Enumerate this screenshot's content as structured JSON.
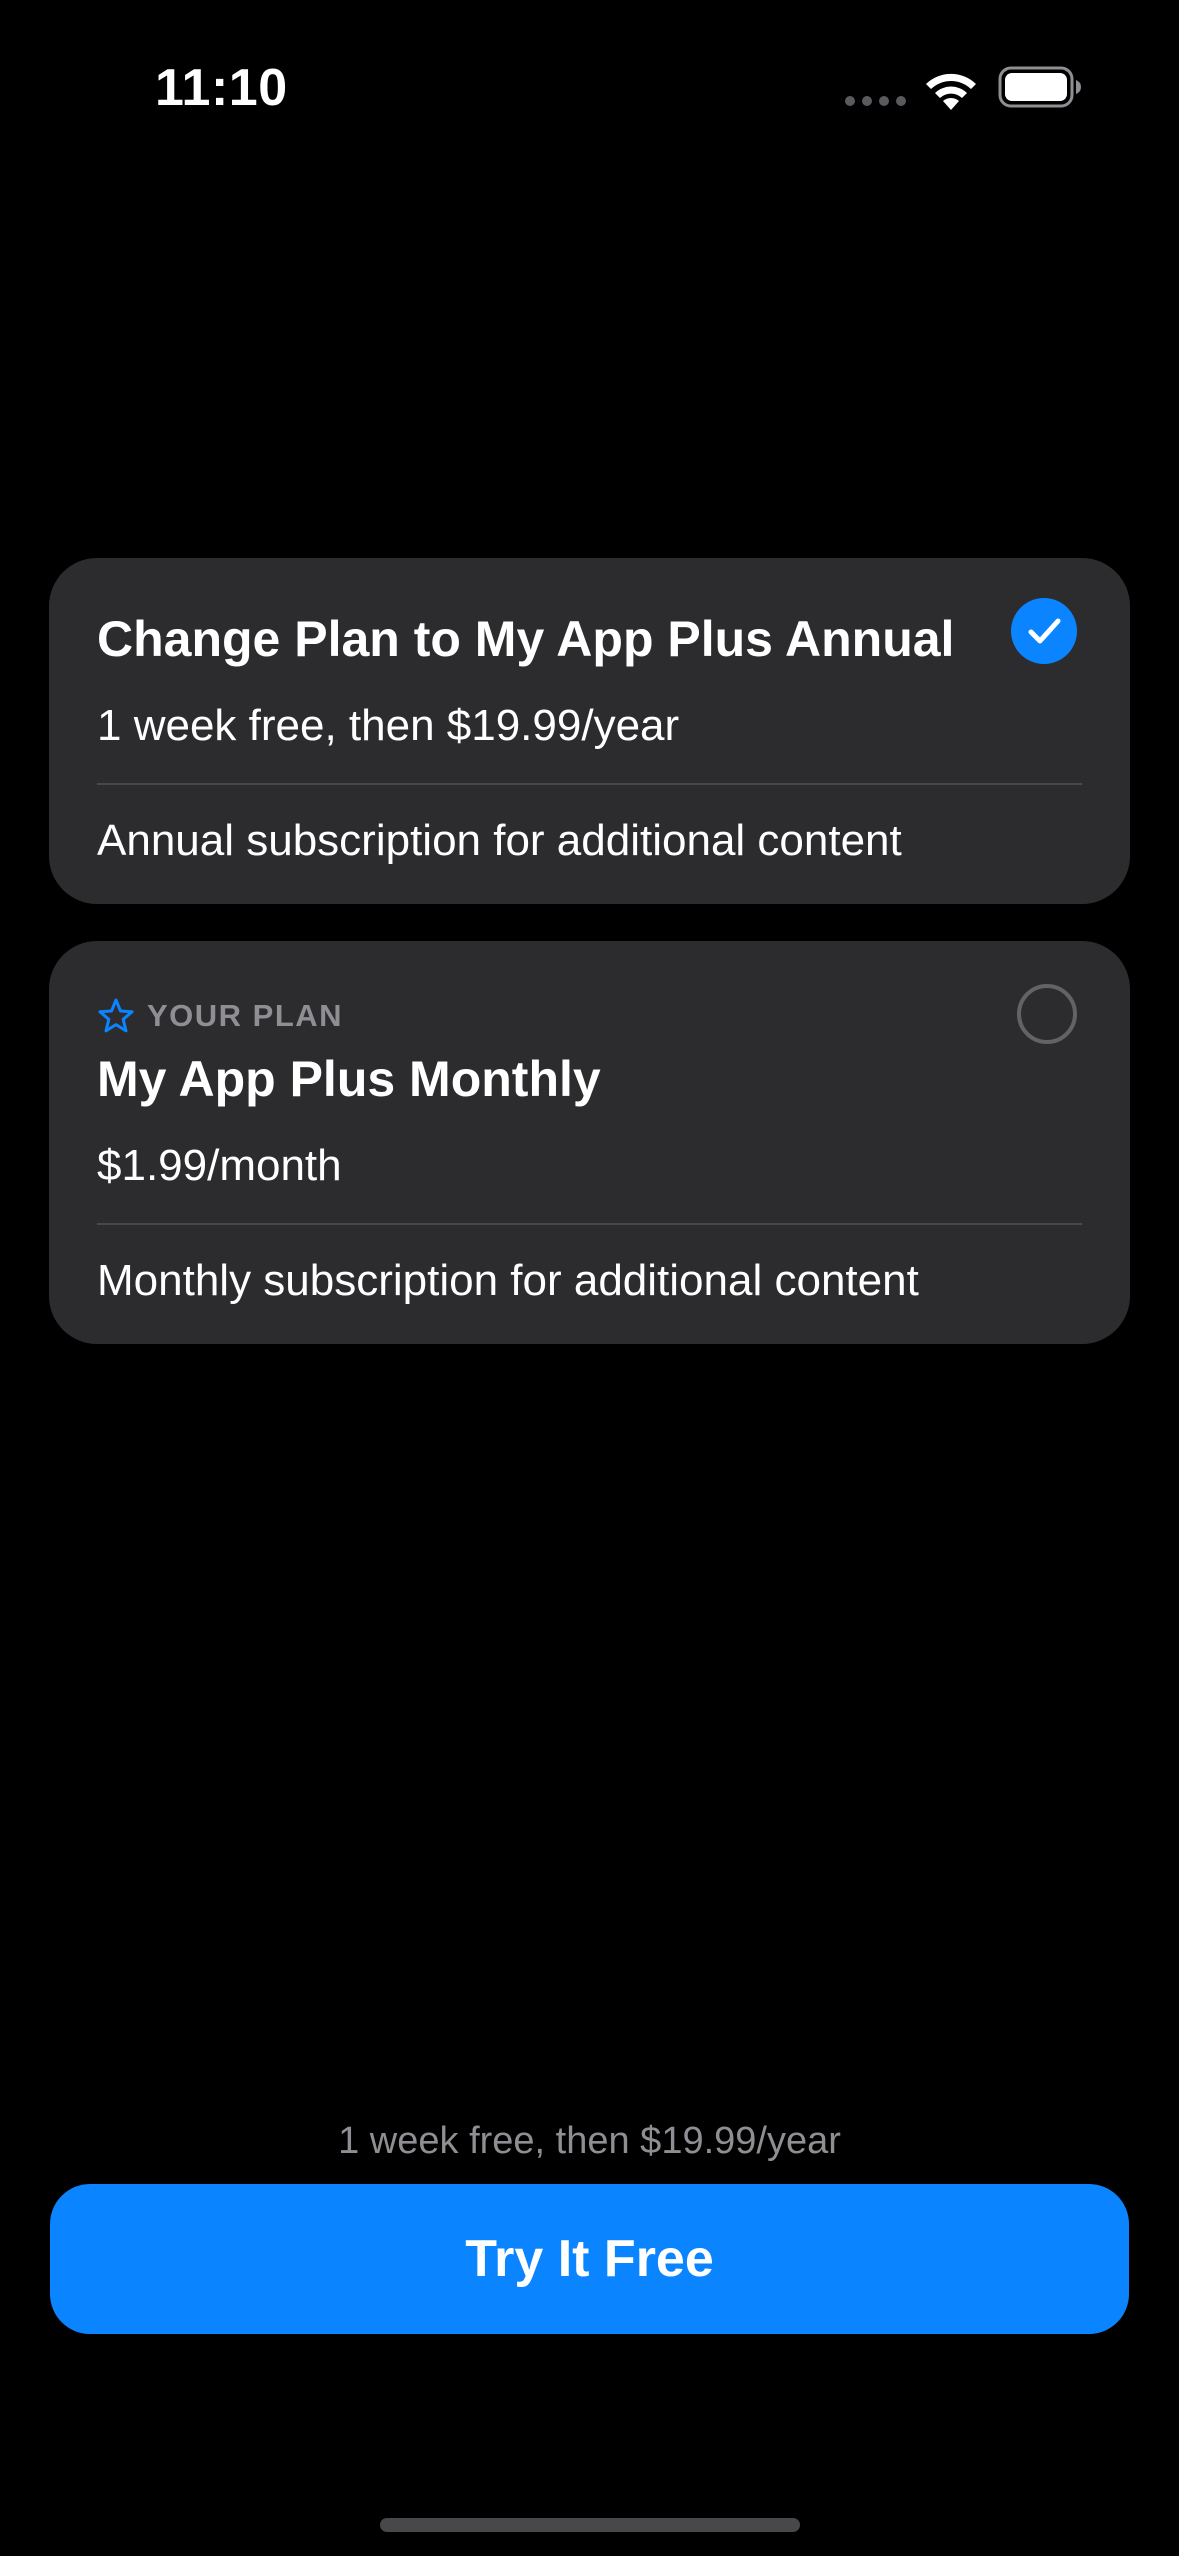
{
  "status_bar": {
    "time": "11:10"
  },
  "plans": [
    {
      "title": "Change Plan to My App Plus Annual",
      "price": "1 week free, then $19.99/year",
      "description": "Annual subscription for additional content",
      "selected": true
    },
    {
      "badge": "YOUR PLAN",
      "badge_icon": "star-icon",
      "title": "My App Plus Monthly",
      "price": "$1.99/month",
      "description": "Monthly subscription for additional content",
      "selected": false
    }
  ],
  "footer": {
    "note": "1 week free, then $19.99/year",
    "button_label": "Try It Free"
  },
  "colors": {
    "background": "#000000",
    "card": "#2c2c2e",
    "accent": "#0a84ff",
    "secondary_text": "#8e8e93"
  }
}
